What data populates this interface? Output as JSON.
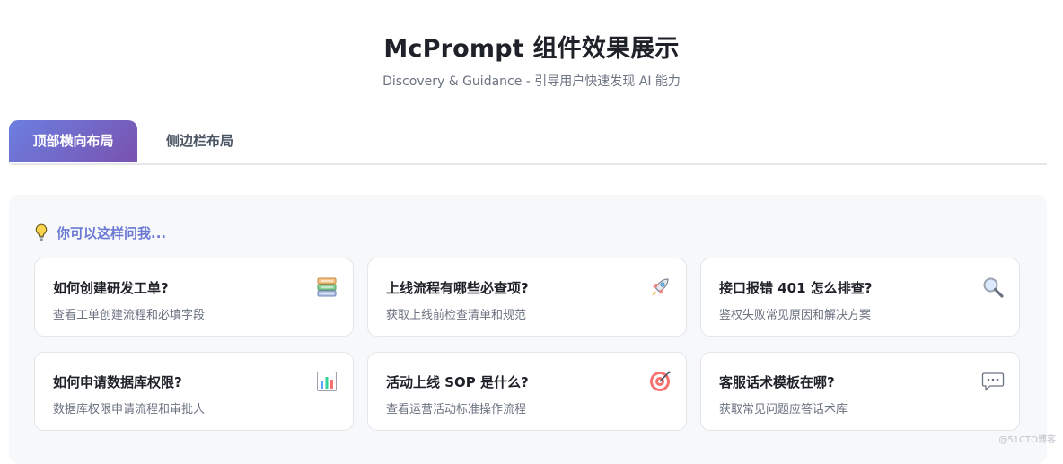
{
  "header": {
    "title": "McPrompt 组件效果展示",
    "subtitle": "Discovery & Guidance - 引导用户快速发现 AI 能力"
  },
  "tabs": [
    {
      "label": "顶部横向布局",
      "active": true
    },
    {
      "label": "侧边栏布局",
      "active": false
    }
  ],
  "panel": {
    "hint_icon": "lightbulb-icon",
    "hint_label": "你可以这样问我...",
    "cards": [
      {
        "title": "如何创建研发工单?",
        "desc": "查看工单创建流程和必填字段",
        "icon": "books-icon"
      },
      {
        "title": "上线流程有哪些必查项?",
        "desc": "获取上线前检查清单和规范",
        "icon": "rocket-icon"
      },
      {
        "title": "接口报错 401 怎么排查?",
        "desc": "鉴权失败常见原因和解决方案",
        "icon": "magnifier-icon"
      },
      {
        "title": "如何申请数据库权限?",
        "desc": "数据库权限申请流程和审批人",
        "icon": "bar-chart-icon"
      },
      {
        "title": "活动上线 SOP 是什么?",
        "desc": "查看运营活动标准操作流程",
        "icon": "target-icon"
      },
      {
        "title": "客服话术模板在哪?",
        "desc": "获取常见问题应答话术库",
        "icon": "speech-bubble-icon"
      }
    ]
  },
  "watermark": "@51CTO博客",
  "colors": {
    "accent_start": "#6b7fe0",
    "accent_end": "#7a52b0",
    "hint_text": "#6c7ad6",
    "panel_bg": "#f6f8fa"
  }
}
